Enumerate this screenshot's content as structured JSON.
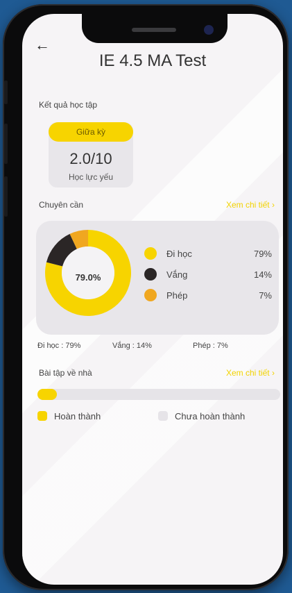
{
  "header": {
    "title": "IE 4.5 MA Test",
    "back_icon": "arrow-left-icon"
  },
  "results": {
    "section_label": "Kết quả học tập",
    "term_label": "Giữa kỳ",
    "score": "2.0/10",
    "classification": "Học lực yếu"
  },
  "attendance": {
    "section_label": "Chuyên cần",
    "detail_link": "Xem chi tiết",
    "center_label": "79.0%",
    "legend": [
      {
        "name": "Đi học",
        "value": "79%",
        "color": "#f7d400",
        "fraction": 0.79
      },
      {
        "name": "Vắng",
        "value": "14%",
        "color": "#2b2626",
        "fraction": 0.14
      },
      {
        "name": "Phép",
        "value": "7%",
        "color": "#f0a720",
        "fraction": 0.07
      }
    ],
    "summary": {
      "present": "Đi học : 79%",
      "absent": "Vắng : 14%",
      "excused": "Phép : 7%"
    }
  },
  "homework": {
    "section_label": "Bài tập về nhà",
    "detail_link": "Xem chi tiết",
    "progress_fraction": 0.08,
    "legend_done": "Hoàn thành",
    "legend_not_done": "Chưa hoàn thành",
    "colors": {
      "done": "#f7d400",
      "not_done": "#e6e4e8"
    }
  }
}
